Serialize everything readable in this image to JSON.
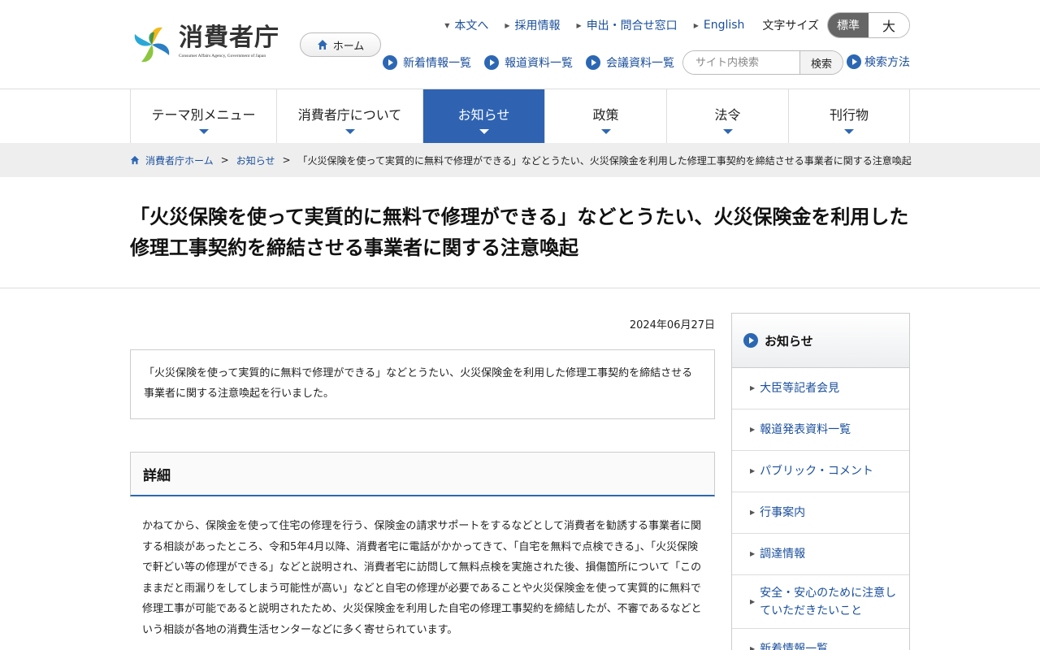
{
  "header": {
    "logo_text": "消費者庁",
    "logo_subtitle": "Consumer Affairs Agency, Government of Japan",
    "home_label": "ホーム",
    "top_links": [
      "本文へ",
      "採用情報",
      "申出・問合せ窓口",
      "English"
    ],
    "font_size_label": "文字サイズ",
    "font_size_options": [
      "標準",
      "大"
    ],
    "sub_links": [
      "新着情報一覧",
      "報道資料一覧",
      "会議資料一覧"
    ],
    "search_placeholder": "サイト内検索",
    "search_button": "検索",
    "search_help": "検索方法"
  },
  "global_nav": [
    "テーマ別メニュー",
    "消費者庁について",
    "お知らせ",
    "政策",
    "法令",
    "刊行物"
  ],
  "breadcrumb": {
    "home": "消費者庁ホーム",
    "parent": "お知らせ",
    "current": "「火災保険を使って実質的に無料で修理ができる」などとうたい、火災保険金を利用した修理工事契約を締結させる事業者に関する注意喚起"
  },
  "page": {
    "title": "「火災保険を使って実質的に無料で修理ができる」などとうたい、火災保険金を利用した修理工事契約を締結させる事業者に関する注意喚起",
    "date": "2024年06月27日",
    "summary": "「火災保険を使って実質的に無料で修理ができる」などとうたい、火災保険金を利用した修理工事契約を締結させる事業者に関する注意喚起を行いました。",
    "section_title": "詳細",
    "body": "かねてから、保険金を使って住宅の修理を行う、保険金の請求サポートをするなどとして消費者を勧誘する事業者に関する相談があったところ、令和5年4月以降、消費者宅に電話がかかってきて、「自宅を無料で点検できる」、「火災保険で軒どい等の修理ができる」などと説明され、消費者宅に訪問して無料点検を実施された後、損傷箇所について「このままだと雨漏りをしてしまう可能性が高い」などと自宅の修理が必要であることや火災保険金を使って実質的に無料で修理工事が可能であると説明されたため、火災保険金を利用した自宅の修理工事契約を締結したが、不審であるなどという相談が各地の消費生活センターなどに多く寄せられています。"
  },
  "sidebar": {
    "title": "お知らせ",
    "items": [
      "大臣等記者会見",
      "報道発表資料一覧",
      "パブリック・コメント",
      "行事案内",
      "調達情報",
      "安全・安心のために注意していただきたいこと",
      "新着情報一覧"
    ]
  },
  "colors": {
    "accent": "#2f63b2",
    "link": "#1a4f9c"
  }
}
